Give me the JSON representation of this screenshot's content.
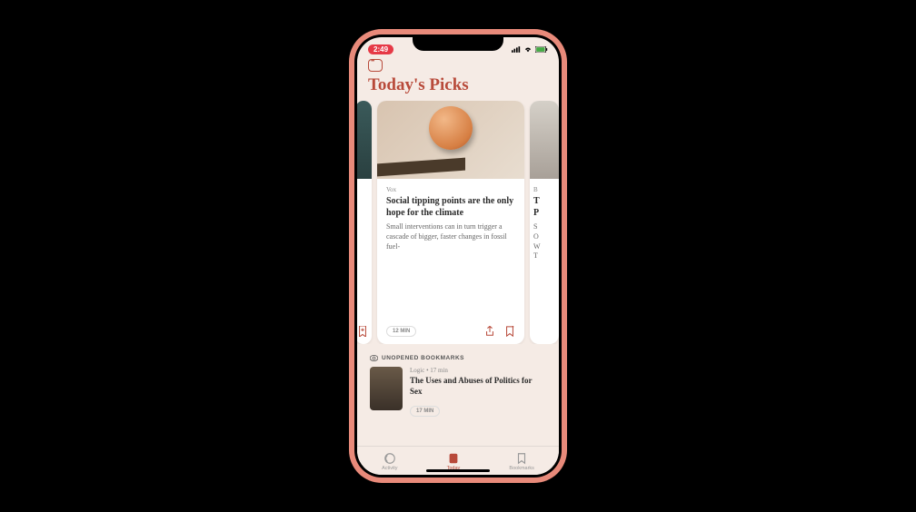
{
  "status": {
    "time": "2:49",
    "signal": "ıl",
    "wifi": "wifi",
    "battery": "battery"
  },
  "header": {
    "title": "Today's Picks"
  },
  "carousel": {
    "main": {
      "source": "Vox",
      "title": "Social tipping points are the only hope for the climate",
      "excerpt": "Small interventions can in turn trigger a cascade of bigger, faster changes in fossil fuel-",
      "read_time": "12 MIN"
    },
    "right": {
      "source_initial": "B",
      "title_fragment": "T\nP",
      "excerpt_fragment": "S\nO\nW\nT"
    }
  },
  "unopened": {
    "section_label": "UNOPENED BOOKMARKS",
    "item": {
      "meta": "Logic • 17 min",
      "title": "The Uses and Abuses of Politics for Sex",
      "read_time": "17 MIN"
    }
  },
  "tabs": {
    "activity": "Activity",
    "today": "Today",
    "bookmarks": "Bookmarks"
  }
}
